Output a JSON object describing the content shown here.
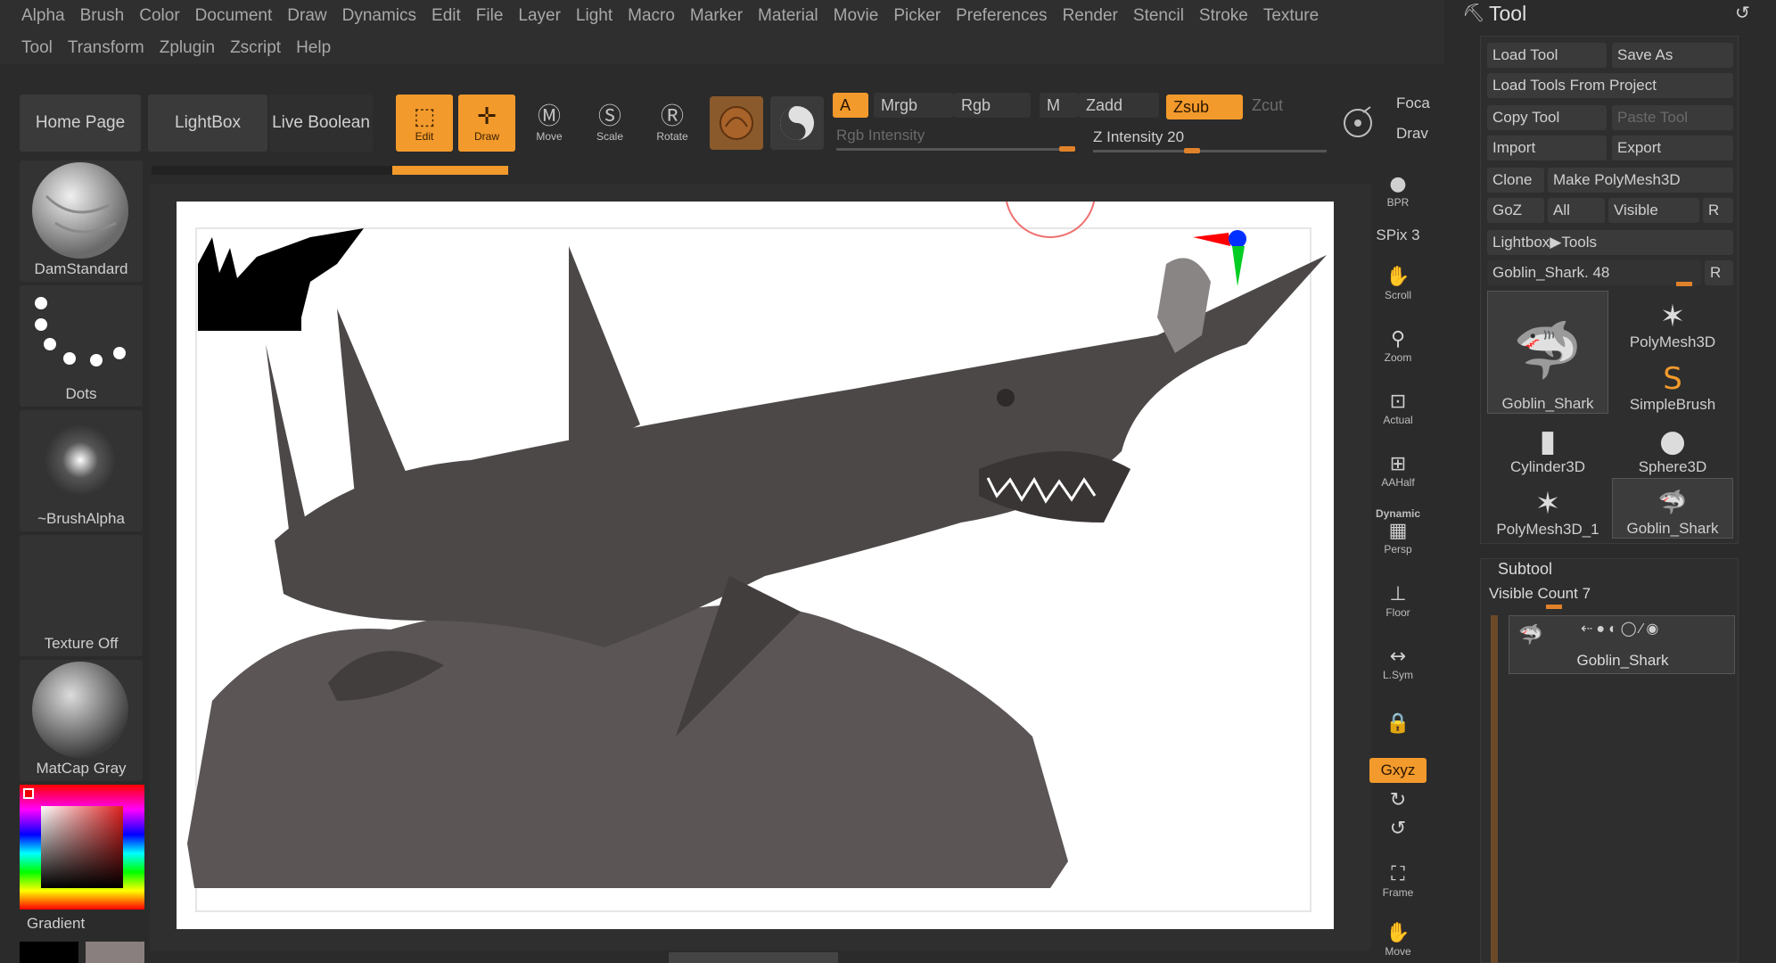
{
  "menubar": {
    "row1": [
      "Alpha",
      "Brush",
      "Color",
      "Document",
      "Draw",
      "Dynamics",
      "Edit",
      "File",
      "Layer",
      "Light",
      "Macro",
      "Marker",
      "Material",
      "Movie",
      "Picker",
      "Preferences",
      "Render",
      "Stencil",
      "Stroke",
      "Texture"
    ],
    "row2": [
      "Tool",
      "Transform",
      "Zplugin",
      "Zscript",
      "Help"
    ]
  },
  "toolbar": {
    "home_page": "Home Page",
    "lightbox": "LightBox",
    "live_boolean": "Live Boolean",
    "edit": "Edit",
    "draw": "Draw",
    "move": "Move",
    "scale": "Scale",
    "rotate": "Rotate",
    "opt_a": "A",
    "mrgb": "Mrgb",
    "rgb": "Rgb",
    "m": "M",
    "zadd": "Zadd",
    "zsub": "Zsub",
    "zcut": "Zcut",
    "rgb_intensity": "Rgb Intensity",
    "z_intensity": "Z Intensity 20",
    "focal": "Foca",
    "draw_size": "Drav"
  },
  "left_palette": {
    "brush": "DamStandard",
    "stroke": "Dots",
    "alpha": "~BrushAlpha",
    "texture": "Texture Off",
    "material": "MatCap Gray",
    "gradient": "Gradient"
  },
  "right_strip": {
    "bpr": "BPR",
    "spix": "SPix 3",
    "scroll": "Scroll",
    "zoom": "Zoom",
    "actual": "Actual",
    "aahalf": "AAHalf",
    "dynamic": "Dynamic",
    "persp": "Persp",
    "floor": "Floor",
    "lsym": "L.Sym",
    "xyz": "Gxyz",
    "frame": "Frame",
    "move": "Move"
  },
  "tool_panel": {
    "title": "Tool",
    "load_tool": "Load Tool",
    "save_as": "Save As",
    "load_from_project": "Load Tools From Project",
    "copy_tool": "Copy Tool",
    "paste_tool": "Paste Tool",
    "import": "Import",
    "export": "Export",
    "clone": "Clone",
    "make_polymesh": "Make PolyMesh3D",
    "goz": "GoZ",
    "all": "All",
    "visible": "Visible",
    "r": "R",
    "lightbox_tools": "Lightbox▶Tools",
    "current_tool": "Goblin_Shark. 48",
    "tools": [
      {
        "name": "Goblin_Shark",
        "icon": "shark-icon"
      },
      {
        "name": "PolyMesh3D",
        "icon": "star-icon"
      },
      {
        "name": "SimpleBrush",
        "icon": "s-brush-icon"
      },
      {
        "name": "Cylinder3D",
        "icon": "cylinder-icon"
      },
      {
        "name": "Sphere3D",
        "icon": "sphere-icon"
      },
      {
        "name": "PolyMesh3D_1",
        "icon": "star-icon"
      },
      {
        "name": "Goblin_Shark",
        "icon": "shark-icon"
      }
    ],
    "subtool": {
      "title": "Subtool",
      "visible_count": "Visible Count 7",
      "item": "Goblin_Shark"
    }
  },
  "colors": {
    "accent": "#f39a2c",
    "panel": "#2b2b2b",
    "button": "#3a3a3a"
  }
}
